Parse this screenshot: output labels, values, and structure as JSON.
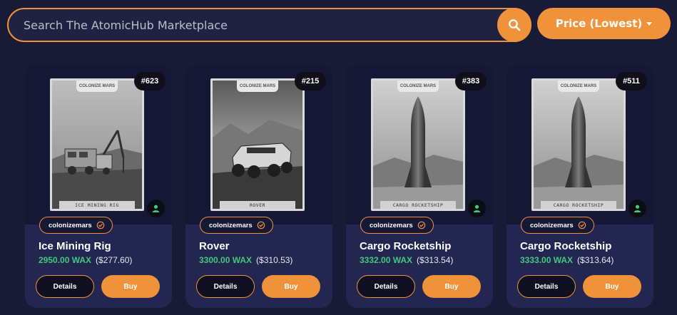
{
  "search": {
    "placeholder": "Search The AtomicHub Marketplace",
    "icon": "search-icon"
  },
  "sort": {
    "label": "Price (Lowest)",
    "icon": "chevron-down-icon"
  },
  "colors": {
    "background": "#181a36",
    "card": "#222650",
    "accent": "#f0923a",
    "wax_price": "#42c97a",
    "owner_icon": "#42c97a"
  },
  "listings": [
    {
      "mint": "#623",
      "frame_logo": "COLONIZE MARS",
      "frame_caption": "ICE MINING RIG",
      "collection": "colonizemars",
      "name": "Ice Mining Rig",
      "price_wax": "2950.00 WAX",
      "price_usd": "($277.60)",
      "details_label": "Details",
      "buy_label": "Buy"
    },
    {
      "mint": "#215",
      "frame_logo": "COLONIZE MARS",
      "frame_caption": "ROVER",
      "collection": "colonizemars",
      "name": "Rover",
      "price_wax": "3300.00 WAX",
      "price_usd": "($310.53)",
      "details_label": "Details",
      "buy_label": "Buy"
    },
    {
      "mint": "#383",
      "frame_logo": "COLONIZE MARS",
      "frame_caption": "CARGO ROCKETSHIP",
      "collection": "colonizemars",
      "name": "Cargo Rocketship",
      "price_wax": "3332.00 WAX",
      "price_usd": "($313.54)",
      "details_label": "Details",
      "buy_label": "Buy"
    },
    {
      "mint": "#511",
      "frame_logo": "COLONIZE MARS",
      "frame_caption": "CARGO ROCKETSHIP",
      "collection": "colonizemars",
      "name": "Cargo Rocketship",
      "price_wax": "3333.00 WAX",
      "price_usd": "($313.64)",
      "details_label": "Details",
      "buy_label": "Buy"
    }
  ]
}
